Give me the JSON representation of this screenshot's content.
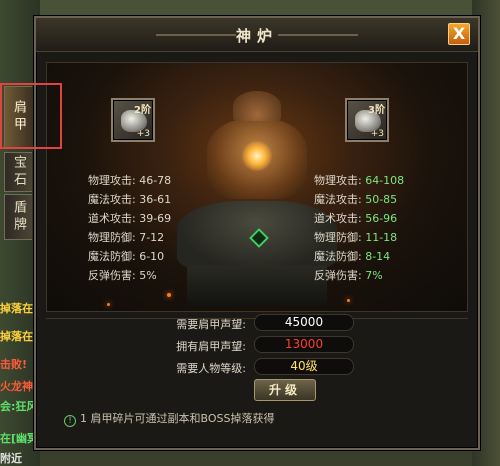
{
  "window": {
    "title": "神炉",
    "close_label": "X"
  },
  "tabs": [
    {
      "label": "肩甲",
      "active": true
    },
    {
      "label": "宝石",
      "active": false
    },
    {
      "label": "盾牌",
      "active": false
    }
  ],
  "slots": {
    "current": {
      "level": "2阶",
      "plus": "+3",
      "icon": "shoulder-armor-icon"
    },
    "next": {
      "level": "3阶",
      "plus": "+3",
      "icon": "shoulder-armor-icon"
    }
  },
  "stats_left": [
    {
      "label": "物理攻击:",
      "value": "46-78"
    },
    {
      "label": "魔法攻击:",
      "value": "36-61"
    },
    {
      "label": "道术攻击:",
      "value": "39-69"
    },
    {
      "label": "物理防御:",
      "value": "7-12"
    },
    {
      "label": "魔法防御:",
      "value": "6-10"
    },
    {
      "label": "反弹伤害:",
      "value": "5%"
    }
  ],
  "stats_right": [
    {
      "label": "物理攻击:",
      "value": "64-108"
    },
    {
      "label": "魔法攻击:",
      "value": "50-85"
    },
    {
      "label": "道术攻击:",
      "value": "56-96"
    },
    {
      "label": "物理防御:",
      "value": "11-18"
    },
    {
      "label": "魔法防御:",
      "value": "8-14"
    },
    {
      "label": "反弹伤害:",
      "value": "7%"
    }
  ],
  "requirements": [
    {
      "label": "需要肩甲声望:",
      "value": "45000",
      "color": "#ffffff"
    },
    {
      "label": "拥有肩甲声望:",
      "value": "13000",
      "color": "#ff3d2e"
    },
    {
      "label": "需要人物等级:",
      "value": "40级",
      "color": "#ffe36a"
    }
  ],
  "upgrade_label": "升级",
  "hint": "1 肩甲碎片可通过副本和BOSS掉落获得",
  "chat": [
    {
      "text": "掉落在[",
      "color": "#ffd23a"
    },
    {
      "text": "掉落在[",
      "color": "#ffd23a"
    },
    {
      "text": "击败!",
      "color": "#ff5a3a"
    },
    {
      "text": "火龙神[",
      "color": "#ff5a3a"
    },
    {
      "text": "会:狂风1$",
      "color": "#5fe06a"
    },
    {
      "text": "在[幽冥",
      "color": "#5fe06a"
    },
    {
      "text": "附近",
      "color": "#e0e0e0"
    }
  ]
}
